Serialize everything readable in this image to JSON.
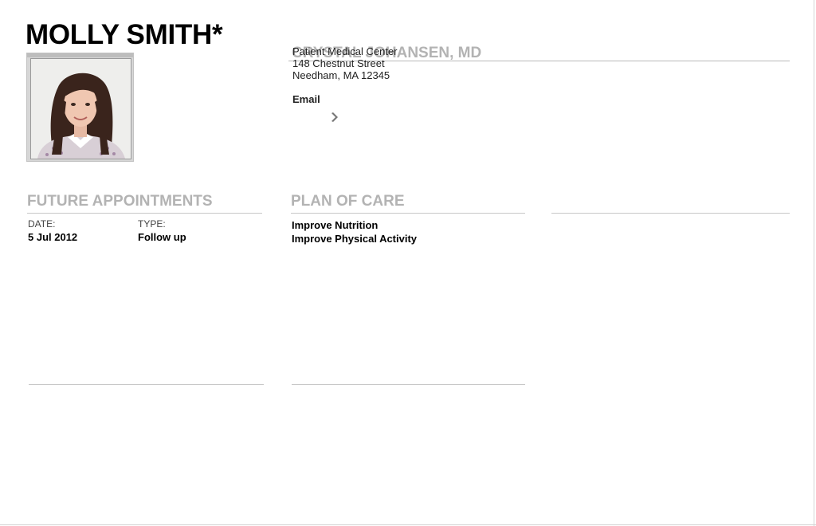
{
  "patient": {
    "name": "MOLLY SMITH*",
    "photo_alt": "patient photo"
  },
  "doctor": {
    "name": "CRYSTAL JOHANSEN, MD",
    "clinic": "Patient Medical Center",
    "street": "148 Chestnut Street",
    "city_line": "Needham, MA 12345",
    "email_label": "Email",
    "chevron_icon": "chevron-right-icon"
  },
  "appointments": {
    "title": "FUTURE APPOINTMENTS",
    "headers": {
      "date": "DATE:",
      "type": "TYPE:"
    },
    "rows": [
      {
        "date": "5 Jul 2012",
        "type": "Follow up"
      }
    ]
  },
  "plan": {
    "title": "PLAN OF CARE",
    "items": [
      "Improve Nutrition",
      "Improve Physical Activity"
    ]
  }
}
